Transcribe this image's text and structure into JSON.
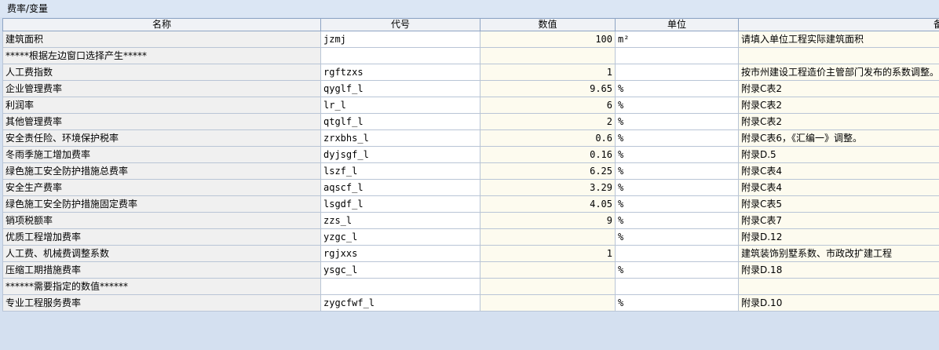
{
  "panel": {
    "title": "费率/变量"
  },
  "columns": [
    "名称",
    "代号",
    "数值",
    "单位",
    "备注"
  ],
  "rows": [
    {
      "name": "建筑面积",
      "code": "jzmj",
      "value": "100",
      "unit": "m²",
      "note": "请填入单位工程实际建筑面积"
    },
    {
      "name": "*****根据左边窗口选择产生*****",
      "code": "",
      "value": "",
      "unit": "",
      "note": ""
    },
    {
      "name": "人工费指数",
      "code": "rgftzxs",
      "value": "1",
      "unit": "",
      "note": "按市州建设工程造价主管部门发布的系数调整。"
    },
    {
      "name": "企业管理费率",
      "code": "qyglf_l",
      "value": "9.65",
      "unit": "%",
      "note": "附录C表2"
    },
    {
      "name": "利润率",
      "code": "lr_l",
      "value": "6",
      "unit": "%",
      "note": "附录C表2"
    },
    {
      "name": "其他管理费率",
      "code": "qtglf_l",
      "value": "2",
      "unit": "%",
      "note": "附录C表2"
    },
    {
      "name": "安全责任险、环境保护税率",
      "code": "zrxbhs_l",
      "value": "0.6",
      "unit": "%",
      "note": "附录C表6，《汇编一》调整。"
    },
    {
      "name": "冬雨季施工增加费率",
      "code": "dyjsgf_l",
      "value": "0.16",
      "unit": "%",
      "note": "附录D.5"
    },
    {
      "name": "绿色施工安全防护措施总费率",
      "code": "lszf_l",
      "value": "6.25",
      "unit": "%",
      "note": "附录C表4"
    },
    {
      "name": "安全生产费率",
      "code": "aqscf_l",
      "value": "3.29",
      "unit": "%",
      "note": "附录C表4"
    },
    {
      "name": "绿色施工安全防护措施固定费率",
      "code": "lsgdf_l",
      "value": "4.05",
      "unit": "%",
      "note": "附录C表5"
    },
    {
      "name": "销项税额率",
      "code": "zzs_l",
      "value": "9",
      "unit": "%",
      "note": "附录C表7"
    },
    {
      "name": "优质工程增加费率",
      "code": "yzgc_l",
      "value": "",
      "unit": "%",
      "note": "附录D.12"
    },
    {
      "name": "人工费、机械费调整系数",
      "code": "rgjxxs",
      "value": "1",
      "unit": "",
      "note": "建筑装饰别墅系数、市政改扩建工程"
    },
    {
      "name": "压缩工期措施费率",
      "code": "ysgc_l",
      "value": "",
      "unit": "%",
      "note": "附录D.18"
    },
    {
      "name": "******需要指定的数值******",
      "code": "",
      "value": "",
      "unit": "",
      "note": ""
    },
    {
      "name": "专业工程服务费率",
      "code": "zygcfwf_l",
      "value": "",
      "unit": "%",
      "note": "附录D.10"
    }
  ]
}
